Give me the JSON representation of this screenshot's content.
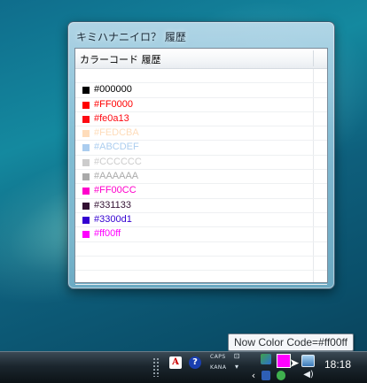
{
  "window": {
    "title": "キミハナニイロ？ 履歴",
    "column_header": "カラーコード 履歴",
    "history": [
      {
        "code": "",
        "color": ""
      },
      {
        "code": "#000000",
        "color": "#000000"
      },
      {
        "code": "#FF0000",
        "color": "#FF0000"
      },
      {
        "code": "#fe0a13",
        "color": "#fe0a13"
      },
      {
        "code": "#FEDCBA",
        "color": "#FEDCBA"
      },
      {
        "code": "#ABCDEF",
        "color": "#ABCDEF"
      },
      {
        "code": "#CCCCCC",
        "color": "#CCCCCC"
      },
      {
        "code": "#AAAAAA",
        "color": "#AAAAAA"
      },
      {
        "code": "#FF00CC",
        "color": "#FF00CC"
      },
      {
        "code": "#331133",
        "color": "#331133"
      },
      {
        "code": "#3300d1",
        "color": "#3300d1"
      },
      {
        "code": "#ff00ff",
        "color": "#ff00ff"
      },
      {
        "code": "",
        "color": ""
      },
      {
        "code": "",
        "color": ""
      },
      {
        "code": "",
        "color": ""
      }
    ]
  },
  "tooltip": {
    "text": "Now Color Code=#ff00ff"
  },
  "taskbar": {
    "ime_caps": "CAPS",
    "ime_kana": "KANA",
    "clock": "18:18",
    "current_color": "#ff00ff",
    "tray_icons": [
      "adobe-icon",
      "help-icon",
      "network-icon",
      "color-swatch-icon",
      "monitor-icon",
      "speaker-icon"
    ]
  }
}
